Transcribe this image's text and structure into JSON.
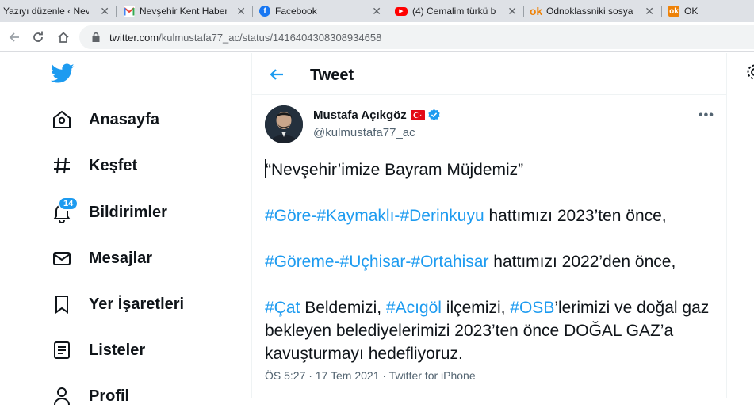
{
  "browser": {
    "tabs": [
      {
        "title": "Yazıyı düzenle ‹ Nevşe",
        "icon": "none"
      },
      {
        "title": "Nevşehir Kent Haber",
        "icon": "gmail-icon"
      },
      {
        "title": "Facebook",
        "icon": "facebook-icon"
      },
      {
        "title": "(4) Cemalim türkü b",
        "icon": "youtube-icon"
      },
      {
        "title": "Odnoklassniki sosyal",
        "icon": "odnoklassniki-icon"
      },
      {
        "title": "OK",
        "icon": "ok-icon"
      }
    ],
    "url_host": "twitter.com",
    "url_path": "/kulmustafa77_ac/status/1416404308308934658"
  },
  "sidebar": {
    "items": [
      {
        "label": "Anasayfa",
        "icon": "home-icon"
      },
      {
        "label": "Keşfet",
        "icon": "hashtag-icon"
      },
      {
        "label": "Bildirimler",
        "icon": "bell-icon",
        "badge": "14"
      },
      {
        "label": "Mesajlar",
        "icon": "envelope-icon"
      },
      {
        "label": "Yer İşaretleri",
        "icon": "bookmark-icon"
      },
      {
        "label": "Listeler",
        "icon": "list-icon"
      },
      {
        "label": "Profil",
        "icon": "profile-icon"
      }
    ]
  },
  "header": {
    "title": "Tweet"
  },
  "tweet": {
    "author_name": "Mustafa Açıkgöz",
    "handle": "@kulmustafa77_ac",
    "p1": "“Nevşehir’imize Bayram Müjdemiz”",
    "p2": {
      "h1": "#Göre",
      "s1": "-",
      "h2": "#Kaymaklı",
      "s2": "-",
      "h3": "#Derinkuyu",
      "rest": " hattımızı 2023’ten önce,"
    },
    "p3": {
      "h1": "#Göreme",
      "s1": "-",
      "h2": "#Uçhisar",
      "s2": "-",
      "h3": "#Ortahisar",
      "rest": " hattımızı 2022’den önce,"
    },
    "p4": {
      "h1": "#Çat",
      "t1": " Beldemizi, ",
      "h2": "#Acıgöl",
      "t2": " ilçemizi, ",
      "h3": "#OSB",
      "t3": "’lerimizi ve doğal gaz bekleyen belediyelerimizi 2023’ten önce DOĞAL GAZ’a kavuşturmayı hedefliyoruz."
    },
    "meta": "ÖS 5:27 · 17 Tem 2021 · Twitter for iPhone"
  },
  "colors": {
    "accent": "#1d9bf0",
    "text": "#0f1419",
    "muted": "#536471"
  }
}
